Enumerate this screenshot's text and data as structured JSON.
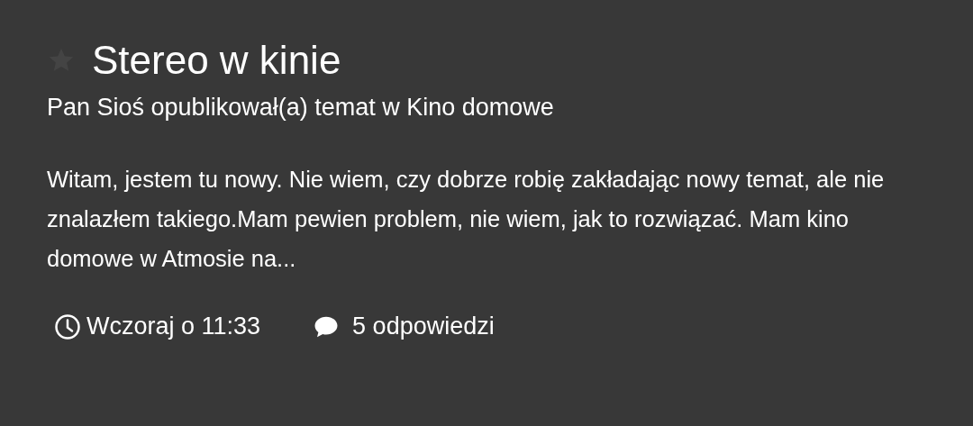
{
  "topic": {
    "starred": false,
    "title": "Stereo w kinie",
    "subtitle": "Pan Sioś opublikował(a) temat w Kino domowe",
    "excerpt": "Witam, jestem tu nowy. Nie wiem, czy dobrze robię zakładając nowy temat, ale nie znalazłem takiego.Mam pewien problem, nie wiem, jak to rozwiązać. Mam kino domowe w Atmosie na...",
    "time": "Wczoraj o 11:33",
    "replies": "5 odpowiedzi"
  }
}
